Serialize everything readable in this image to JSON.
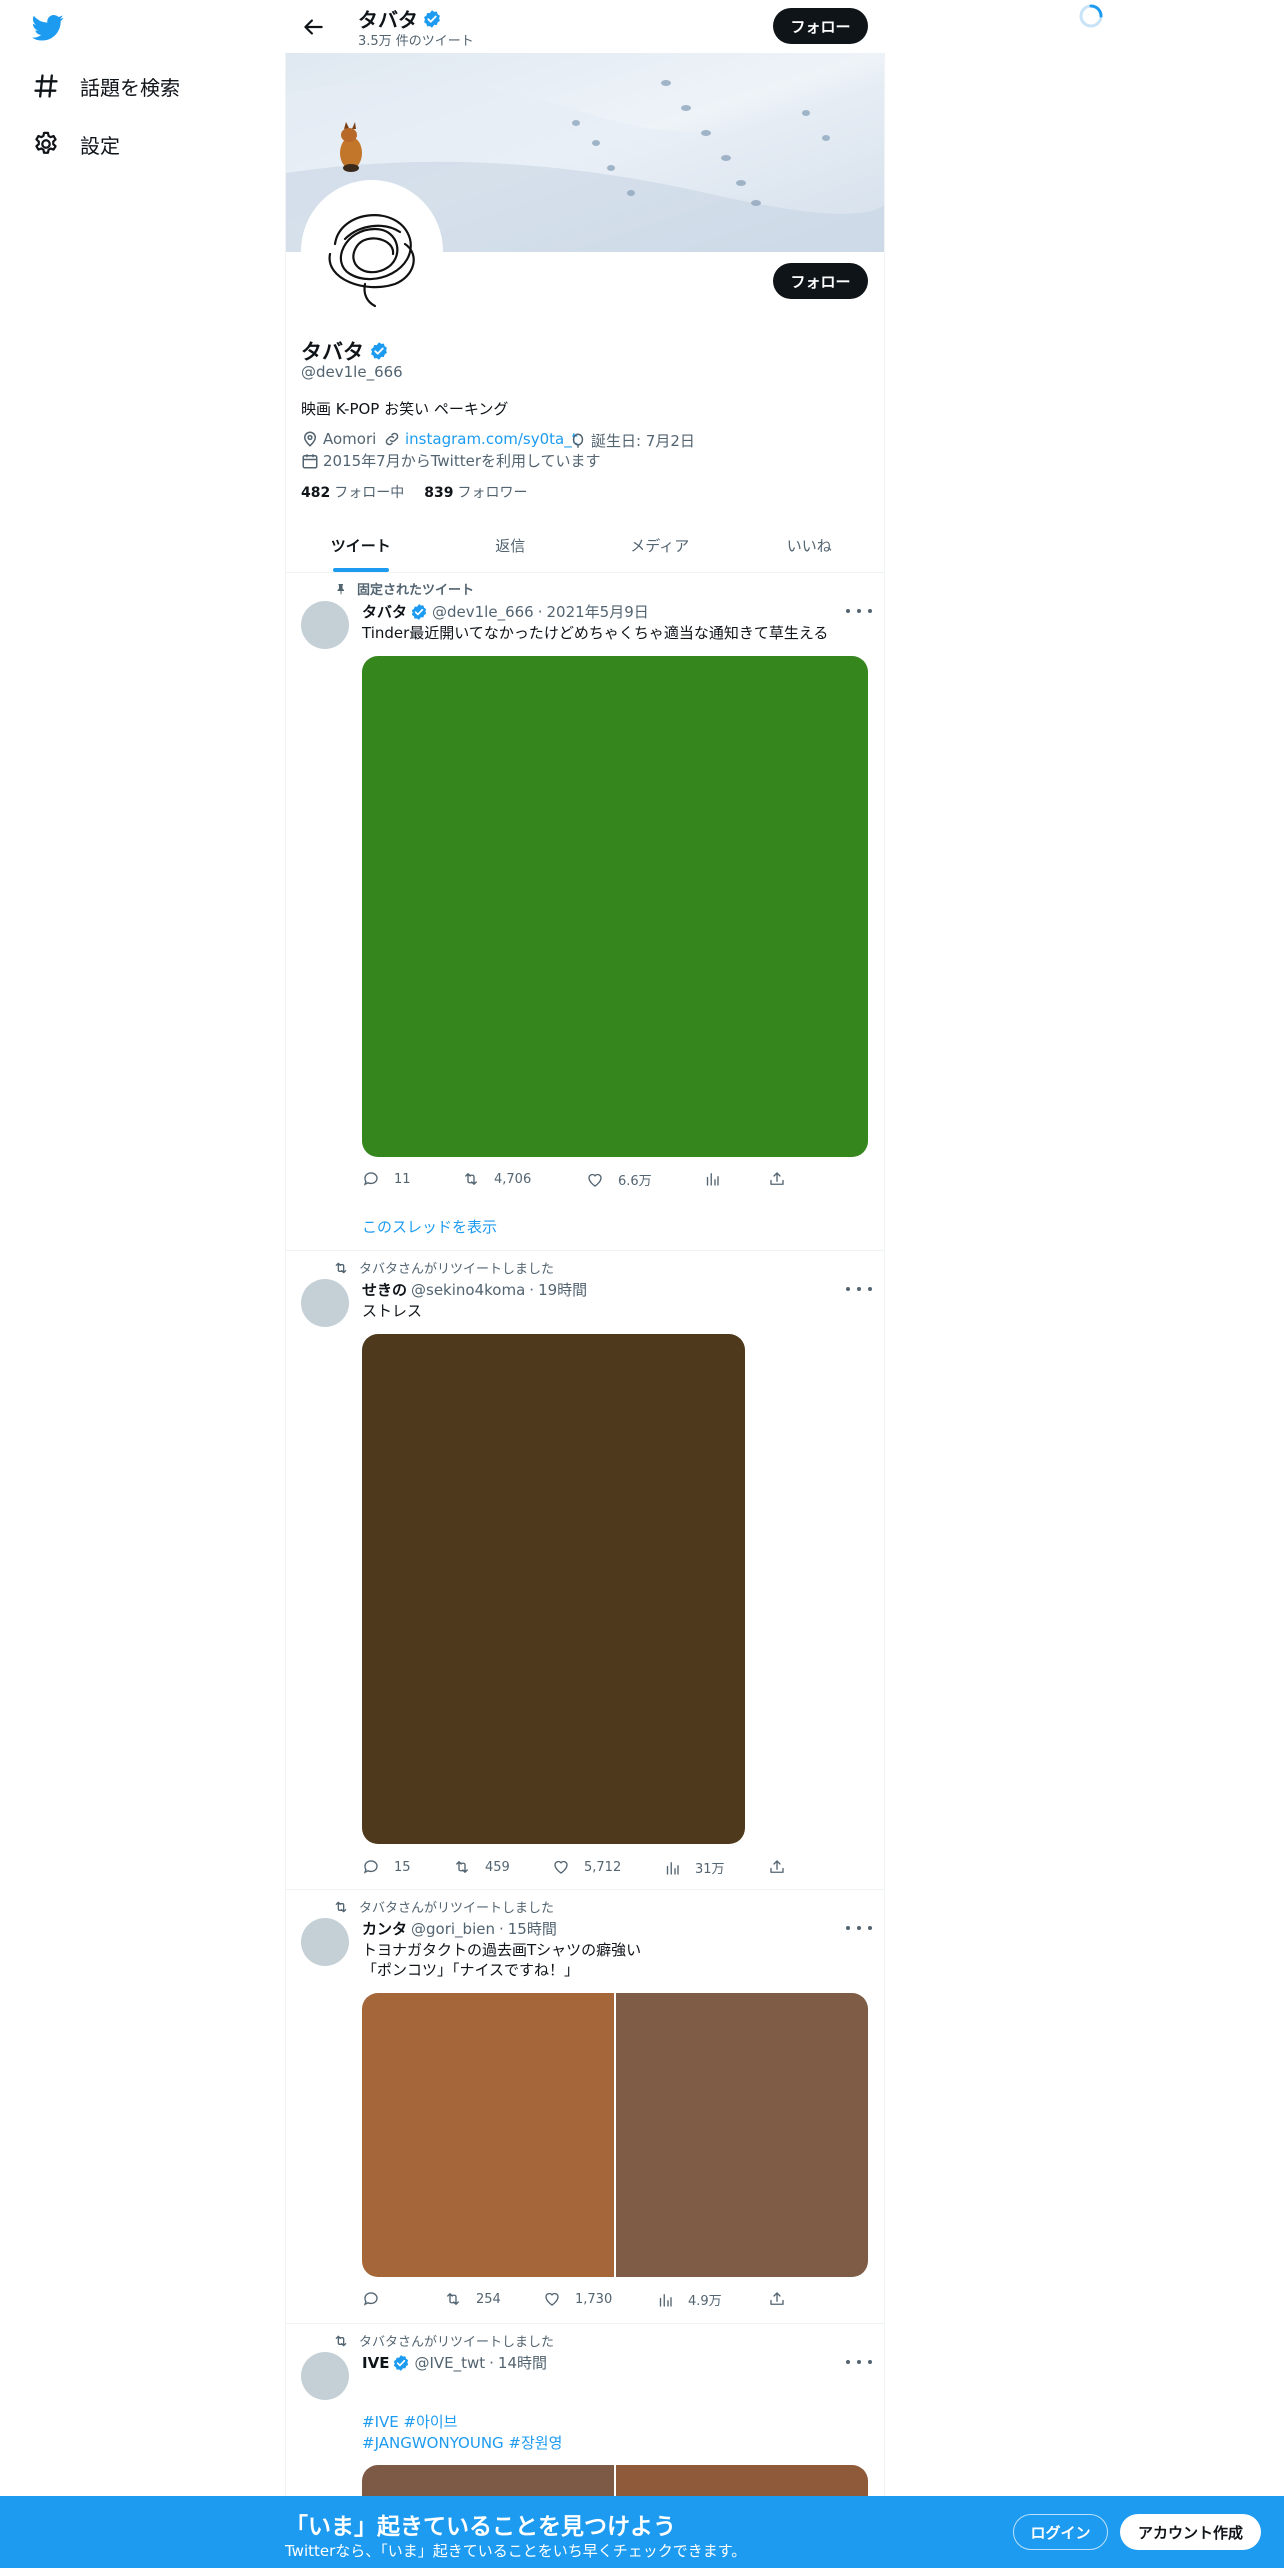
{
  "sidebar": {
    "logo_icon": "twitter-bird-icon",
    "items": [
      {
        "label": "話題を検索",
        "icon": "hashtag-icon"
      },
      {
        "label": "設定",
        "icon": "gear-icon"
      }
    ]
  },
  "header": {
    "name": "タバタ",
    "tweet_count": "3.5万 件のツイート",
    "follow_label": "フォロー"
  },
  "profile": {
    "name": "タバタ",
    "handle": "@dev1le_666",
    "bio": "映画 K-POP お笑い ペーキング",
    "location": "Aomori",
    "url": "instagram.com/sy0ta_t",
    "birthday": "誕生日: 7月2日",
    "joined": "2015年7月からTwitterを利用しています",
    "following_count": "482",
    "following_label": "フォロー中",
    "followers_count": "839",
    "followers_label": "フォロワー",
    "follow_label": "フォロー"
  },
  "tabs": [
    {
      "label": "ツイート",
      "active": true
    },
    {
      "label": "返信",
      "active": false
    },
    {
      "label": "メディア",
      "active": false
    },
    {
      "label": "いいね",
      "active": false
    }
  ],
  "tweets": [
    {
      "context": "固定されたツイート",
      "name": "タバタ",
      "verified": true,
      "handle": "@dev1le_666",
      "time": "2021年5月9日",
      "text": "Tinder最近開いてなかったけどめちゃくちゃ適当な通知きて草生える",
      "media_colors": [
        "#36861e"
      ],
      "replies": "11",
      "retweets": "4,706",
      "likes": "6.6万",
      "views": "",
      "thread_link": "このスレッドを表示"
    },
    {
      "context": "タバタさんがリツイートしました",
      "name": "せきの",
      "verified": false,
      "handle": "@sekino4koma",
      "time": "19時間",
      "text": "ストレス",
      "media_colors": [
        "#4f391c"
      ],
      "replies": "15",
      "retweets": "459",
      "likes": "5,712",
      "views": "31万"
    },
    {
      "context": "タバタさんがリツイートしました",
      "name": "カンタ",
      "verified": false,
      "handle": "@gori_bien",
      "time": "15時間",
      "text_line1": "トヨナガタクトの過去画Tシャツの癖強い",
      "text_line2": "「ポンコツ」「ナイスですね！」",
      "media_colors": [
        "#a5663a",
        "#7f5c46"
      ],
      "replies": "",
      "retweets": "254",
      "likes": "1,730",
      "views": "4.9万"
    },
    {
      "context": "タバタさんがリツイートしました",
      "name": "IVE",
      "verified": true,
      "handle": "@IVE_twt",
      "time": "14時間",
      "hashtags_line1": "#IVE #아이브",
      "hashtags_line2": "#JANGWONYOUNG #장원영",
      "media_colors": [
        "#7d5a45",
        "#8e5a3a"
      ]
    }
  ],
  "bottom_bar": {
    "title": "「いま」起きていることを見つけよう",
    "subtitle": "Twitterなら、「いま」起きていることをいち早くチェックできます。",
    "login_label": "ログイン",
    "signup_label": "アカウント作成"
  },
  "colors": {
    "accent": "#1d9bf0",
    "text": "#0f1419",
    "muted": "#536471"
  }
}
